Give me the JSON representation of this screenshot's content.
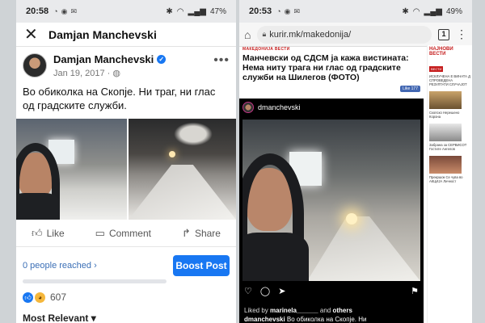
{
  "left": {
    "status": {
      "time": "20:58",
      "battery": "47%"
    },
    "header": {
      "title": "Damjan Manchevski"
    },
    "post": {
      "author": "Damjan Manchevski",
      "date": "Jan 19, 2017 · ",
      "text": "Во обиколка на Скопје. Ни траг, ни глас од градските служби."
    },
    "actions": {
      "like": "Like",
      "comment": "Comment",
      "share": "Share"
    },
    "reach": {
      "text": "0 people reached",
      "fraction": 0.0
    },
    "boost_label": "Boost Post",
    "reactions": {
      "count": "607"
    },
    "sort_label": "Most Relevant"
  },
  "right": {
    "status": {
      "time": "20:53",
      "battery": "49%"
    },
    "browser": {
      "url": "kurir.mk/makedonija/",
      "tabs": "1"
    },
    "article": {
      "crumb": "МАКЕДОНИЈА  ВЕСТИ",
      "headline": "Манчевски од СДСМ ја кажа вистината: Нема ниту трага ни глас од градските служби на Шилегов (ФОТО)",
      "fb_like": "Like 177"
    },
    "instagram": {
      "username": "dmanchevski",
      "liked_prefix": "Liked by ",
      "liked_user": "marinela______",
      "liked_suffix": " and ",
      "liked_others": "others",
      "caption_user": "dmanchevski",
      "caption_text": " Во обиколка на Скопје. Ни"
    },
    "sidebar": {
      "logo": "НАЈНОВИ ВЕСТИ",
      "badge": "ВЕСТИ",
      "items": [
        "ИСКЛУЧЕНА Е ВИНАТА Д СПРОВЕДЕНА РЕЗУЛТАТИ СЛУЧАЈОТ",
        "Скопско Нерешено Корона",
        "Забрана за СЕРВИСОТ Гостите Ангелов",
        "Прекршок Се чува во АКЦИЈА Личност"
      ]
    }
  },
  "colors": {
    "facebook_blue": "#1877f2",
    "news_red": "#c51c1c"
  }
}
